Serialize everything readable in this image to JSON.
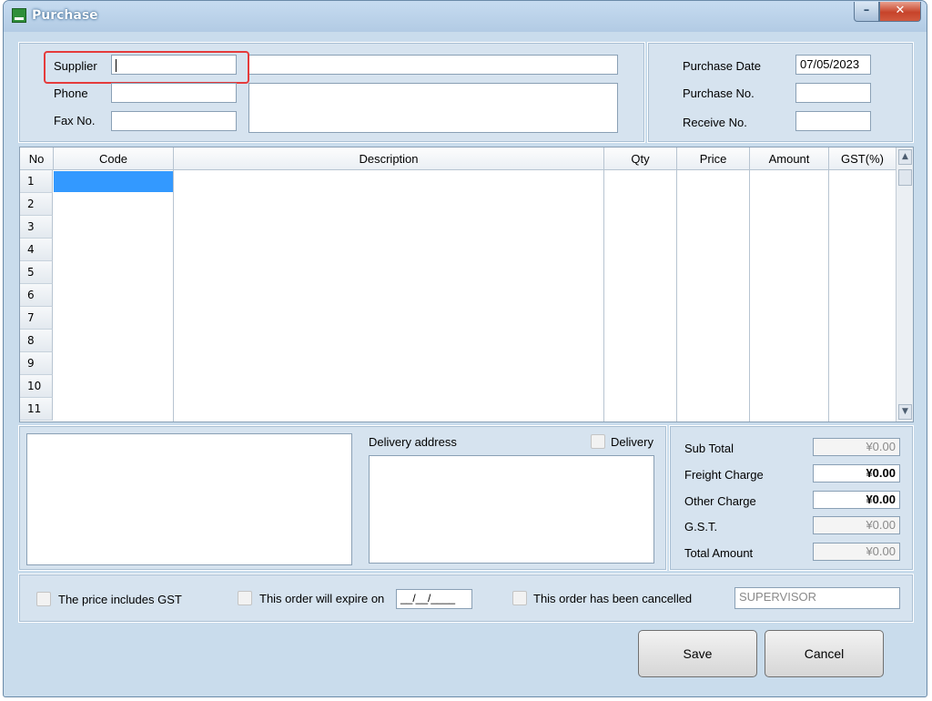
{
  "window": {
    "title": "Purchase"
  },
  "supplier": {
    "label": "Supplier",
    "code_value": "",
    "name_value": ""
  },
  "phone": {
    "label": "Phone",
    "value": ""
  },
  "fax": {
    "label": "Fax No.",
    "value": ""
  },
  "purchase_date": {
    "label": "Purchase Date",
    "value": "07/05/2023"
  },
  "purchase_no": {
    "label": "Purchase No.",
    "value": ""
  },
  "receive_no": {
    "label": "Receive No.",
    "value": ""
  },
  "grid": {
    "columns": [
      "No",
      "Code",
      "Description",
      "Qty",
      "Price",
      "Amount",
      "GST(%)"
    ],
    "row_numbers": [
      "1",
      "2",
      "3",
      "4",
      "5",
      "6",
      "7",
      "8",
      "9",
      "10",
      "11"
    ]
  },
  "delivery": {
    "address_label": "Delivery address",
    "checkbox_label": "Delivery"
  },
  "totals": {
    "sub_total": {
      "label": "Sub Total",
      "value": "¥0.00"
    },
    "freight": {
      "label": "Freight Charge",
      "value": "¥0.00"
    },
    "other": {
      "label": "Other Charge",
      "value": "¥0.00"
    },
    "gst": {
      "label": "G.S.T.",
      "value": "¥0.00"
    },
    "total": {
      "label": "Total Amount",
      "value": "¥0.00"
    }
  },
  "options": {
    "includes_gst": "The price includes GST",
    "expire": "This order will expire on",
    "expire_date": "__/__/____",
    "cancelled": "This order has been cancelled",
    "user": "SUPERVISOR"
  },
  "buttons": {
    "save": "Save",
    "cancel": "Cancel"
  }
}
